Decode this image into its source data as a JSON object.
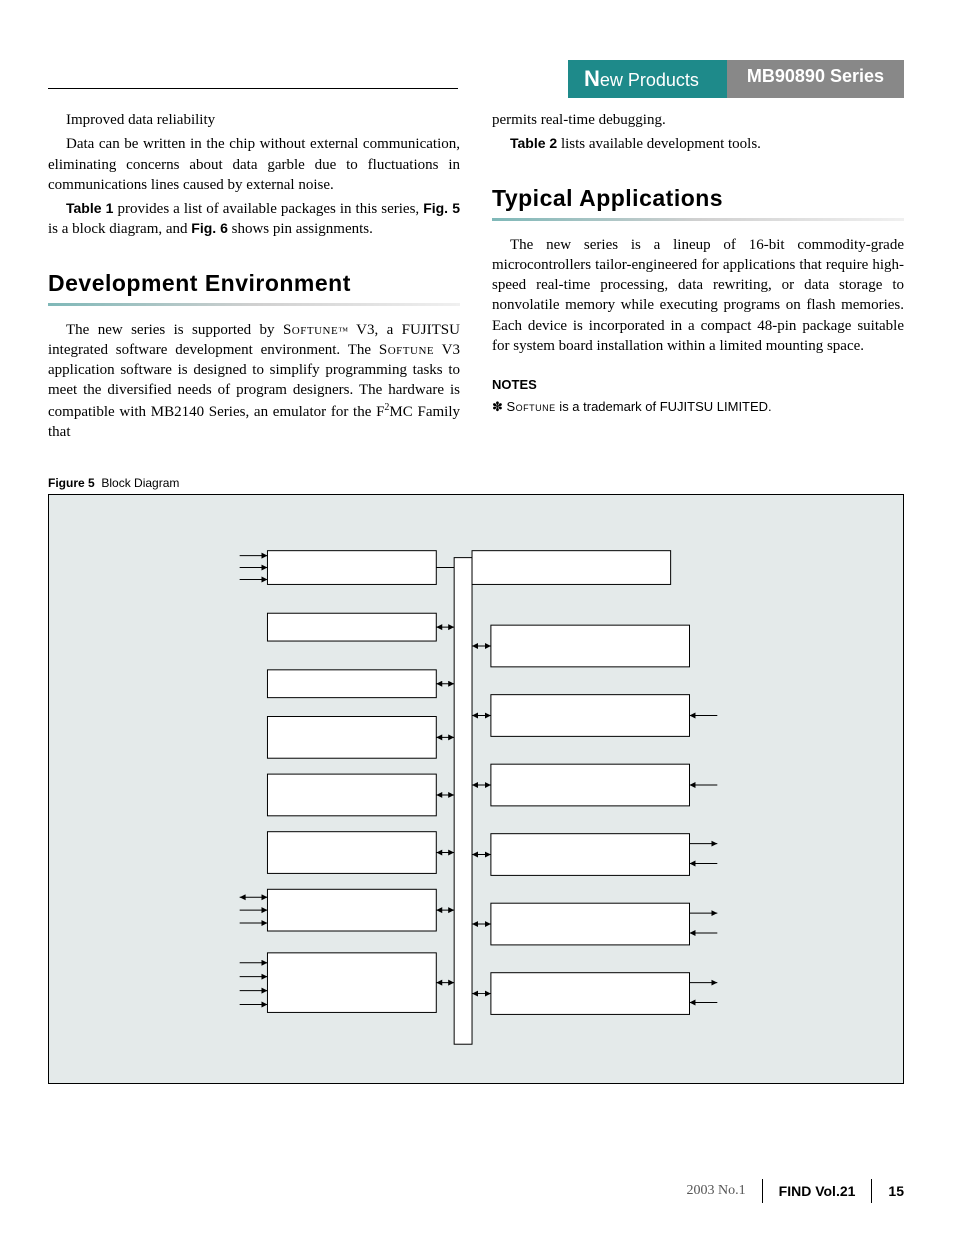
{
  "header": {
    "tab1_big": "N",
    "tab1_rest": "ew Products",
    "tab2": "MB90890 Series"
  },
  "left": {
    "p1": "Improved data reliability",
    "p2": "Data can be written in the chip without external communication, eliminating concerns about data garble due to fluctuations in communications lines caused by external noise.",
    "p3a": "Table 1",
    "p3b": " provides a list of available packages in this series, ",
    "p3c": "Fig. 5",
    "p3d": " is a block diagram, and ",
    "p3e": "Fig. 6",
    "p3f": " shows pin assignments.",
    "h1": "Development Environment",
    "p4a": "The new series is supported by ",
    "p4b": "Softune",
    "p4tm": "™",
    "p4c": " V3, a FUJITSU integrated software development environment. The ",
    "p4d": "Softune",
    "p4e": " V3 application software is designed to simplify programming tasks to meet the diversified needs of program designers. The hardware is compatible with MB2140 Series, an emulator for the F",
    "p4sup": "2",
    "p4f": "MC Family that"
  },
  "right": {
    "p1": "permits real-time debugging.",
    "p2a": "Table 2",
    "p2b": " lists available development tools.",
    "h1": "Typical Applications",
    "p3": "The new series is a lineup of 16-bit commodity-grade microcontrollers tailor-engineered for applications that require high-speed real-time processing, data rewriting, or data storage to nonvolatile memory while executing programs on flash memories. Each device is incorporated in a compact 48-pin package suitable for system board installation within a limited mounting space.",
    "notes_h": "NOTES",
    "notes_a": "✽ ",
    "notes_b": "Softune",
    "notes_c": " is a trademark of FUJITSU LIMITED."
  },
  "figure": {
    "label": "Figure 5",
    "title": "Block Diagram"
  },
  "footer": {
    "year_issue": "2003  No.1",
    "mag": "FIND Vol.21",
    "page": "15"
  }
}
